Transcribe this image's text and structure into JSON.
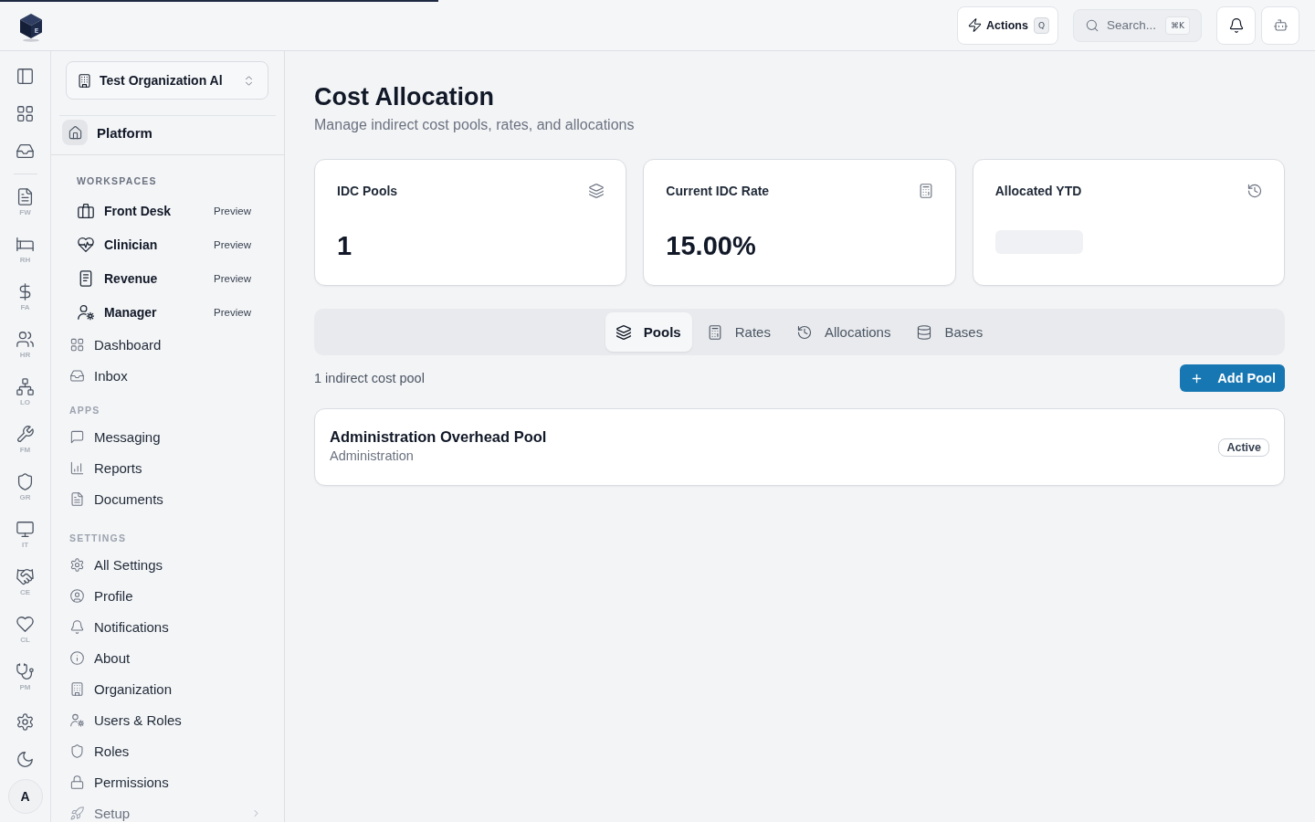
{
  "loading_bar": {
    "level": 0.333
  },
  "header": {
    "logo": {
      "letter": "E"
    },
    "actions": {
      "label": "Actions",
      "shortcut": "Q"
    },
    "search": {
      "placeholder": "Search...",
      "shortcut": "⌘K"
    }
  },
  "rail": {
    "modules": [
      {
        "label": "FW"
      },
      {
        "label": "RH"
      },
      {
        "label": "FA"
      },
      {
        "label": "HR"
      },
      {
        "label": "LO"
      },
      {
        "label": "FM"
      },
      {
        "label": "GR"
      },
      {
        "label": "IT"
      },
      {
        "label": "CE"
      },
      {
        "label": "CL"
      },
      {
        "label": "PM"
      }
    ],
    "avatar": {
      "initial": "A"
    }
  },
  "sidebar": {
    "organization": {
      "value": "Test Organization Al"
    },
    "platform": {
      "label": "Platform"
    },
    "sections": [
      {
        "title": "WORKSPACES",
        "items": [
          {
            "kind": "workspace",
            "label": "Front Desk",
            "badge": "Preview"
          },
          {
            "kind": "workspace",
            "label": "Clinician",
            "badge": "Preview"
          },
          {
            "kind": "workspace",
            "label": "Revenue",
            "badge": "Preview"
          },
          {
            "kind": "workspace",
            "label": "Manager",
            "badge": "Preview"
          },
          {
            "kind": "link",
            "label": "Dashboard"
          },
          {
            "kind": "link",
            "label": "Inbox"
          }
        ]
      },
      {
        "title": "APPS",
        "items": [
          {
            "kind": "link",
            "label": "Messaging"
          },
          {
            "kind": "link",
            "label": "Reports"
          },
          {
            "kind": "link",
            "label": "Documents"
          }
        ]
      },
      {
        "title": "SETTINGS",
        "items": [
          {
            "kind": "link",
            "label": "All Settings"
          },
          {
            "kind": "link",
            "label": "Profile"
          },
          {
            "kind": "link",
            "label": "Notifications"
          },
          {
            "kind": "link",
            "label": "About"
          },
          {
            "kind": "link",
            "label": "Organization"
          },
          {
            "kind": "link",
            "label": "Users & Roles"
          },
          {
            "kind": "link",
            "label": "Roles"
          },
          {
            "kind": "link",
            "label": "Permissions"
          },
          {
            "kind": "group",
            "label": "Setup",
            "expanded": false
          }
        ]
      }
    ]
  },
  "page": {
    "title": "Cost Allocation",
    "subtitle": "Manage indirect cost pools, rates, and allocations"
  },
  "stats": [
    {
      "label": "IDC Pools",
      "value": "1",
      "loading": false
    },
    {
      "label": "Current IDC Rate",
      "value": "15.00%",
      "loading": false
    },
    {
      "label": "Allocated YTD",
      "loading": true
    }
  ],
  "tabs": [
    {
      "label": "Pools",
      "selected": true
    },
    {
      "label": "Rates",
      "selected": false
    },
    {
      "label": "Allocations",
      "selected": false
    },
    {
      "label": "Bases",
      "selected": false
    }
  ],
  "pools_summary": "1 indirect cost pool",
  "add_button": {
    "label": "Add Pool"
  },
  "pools": [
    {
      "name": "Administration Overhead Pool",
      "category": "Administration",
      "status": "Active"
    }
  ]
}
